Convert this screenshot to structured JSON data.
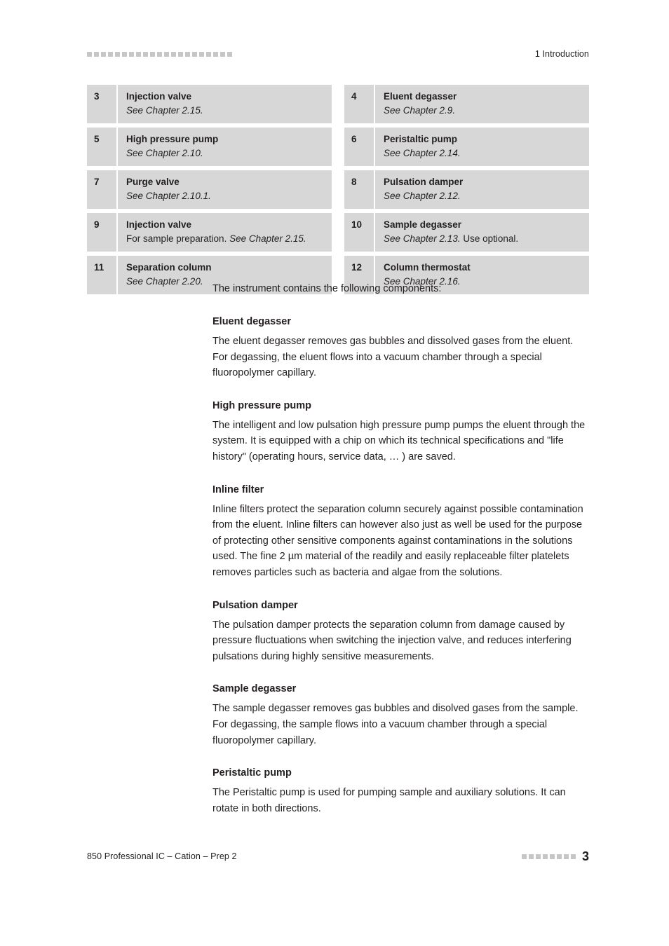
{
  "header": {
    "chapter_label": "1 Introduction",
    "rule_square_count": 21,
    "rule_color": "#c6c6c6"
  },
  "legend": {
    "row_background": "#d7d7d7",
    "columns": [
      {
        "side": "left",
        "rows": [
          {
            "number": "3",
            "title": "Injection valve",
            "sub_italic_1": "See Chapter 2.15.",
            "sub_regular_1": "",
            "sub_regular_2": ""
          },
          {
            "number": "5",
            "title": "High pressure pump",
            "sub_italic_1": "See Chapter 2.10.",
            "sub_regular_1": "",
            "sub_regular_2": ""
          },
          {
            "number": "7",
            "title": "Purge valve",
            "sub_italic_1": "See Chapter 2.10.1.",
            "sub_regular_1": "",
            "sub_regular_2": ""
          },
          {
            "number": "9",
            "title": "Injection valve",
            "sub_italic_1": "See Chapter 2.15.",
            "sub_regular_1": "For sample preparation. ",
            "sub_regular_2": ""
          },
          {
            "number": "11",
            "title": "Separation column",
            "sub_italic_1": "See Chapter 2.20.",
            "sub_regular_1": "",
            "sub_regular_2": ""
          }
        ]
      },
      {
        "side": "right",
        "rows": [
          {
            "number": "4",
            "title": "Eluent degasser",
            "sub_italic_1": "See Chapter 2.9.",
            "sub_regular_1": "",
            "sub_regular_2": ""
          },
          {
            "number": "6",
            "title": "Peristaltic pump",
            "sub_italic_1": "See Chapter 2.14.",
            "sub_regular_1": "",
            "sub_regular_2": ""
          },
          {
            "number": "8",
            "title": "Pulsation damper",
            "sub_italic_1": "See Chapter 2.12.",
            "sub_regular_1": "",
            "sub_regular_2": ""
          },
          {
            "number": "10",
            "title": "Sample degasser",
            "sub_italic_1": "See Chapter 2.13.",
            "sub_regular_1": "",
            "sub_regular_2": " Use optional."
          },
          {
            "number": "12",
            "title": "Column thermostat",
            "sub_italic_1": "See Chapter 2.16.",
            "sub_regular_1": "",
            "sub_regular_2": ""
          }
        ]
      }
    ]
  },
  "main": {
    "intro": "The instrument contains the following components:",
    "sections": [
      {
        "heading": "Eluent degasser",
        "body": "The eluent degasser removes gas bubbles and dissolved gases from the eluent. For degassing, the eluent flows into a vacuum chamber through a special fluoropolymer capillary."
      },
      {
        "heading": "High pressure pump",
        "body": "The intelligent and low pulsation high pressure pump pumps the eluent through the system. It is equipped with a chip on which its technical specifications and \"life history\" (operating hours, service data, … ) are saved."
      },
      {
        "heading": "Inline filter",
        "body": "Inline filters protect the separation column securely against possible contamination from the eluent. Inline filters can however also just as well be used for the purpose of protecting other sensitive components against contaminations in the solutions used. The fine 2 µm material of the readily and easily replaceable filter platelets removes particles such as bacteria and algae from the solutions."
      },
      {
        "heading": "Pulsation damper",
        "body": "The pulsation damper protects the separation column from damage caused by pressure fluctuations when switching the injection valve, and reduces interfering pulsations during highly sensitive measurements."
      },
      {
        "heading": "Sample degasser",
        "body": "The sample degasser removes gas bubbles and disolved gases from the sample. For degassing, the sample flows into a vacuum chamber through a special fluoropolymer capillary."
      },
      {
        "heading": "Peristaltic pump",
        "body": "The Peristaltic pump is used for pumping sample and auxiliary solutions. It can rotate in both directions."
      }
    ]
  },
  "footer": {
    "document_title": "850 Professional IC – Cation – Prep 2",
    "page_number": "3",
    "rule_square_count": 8,
    "rule_color": "#c6c6c6"
  }
}
